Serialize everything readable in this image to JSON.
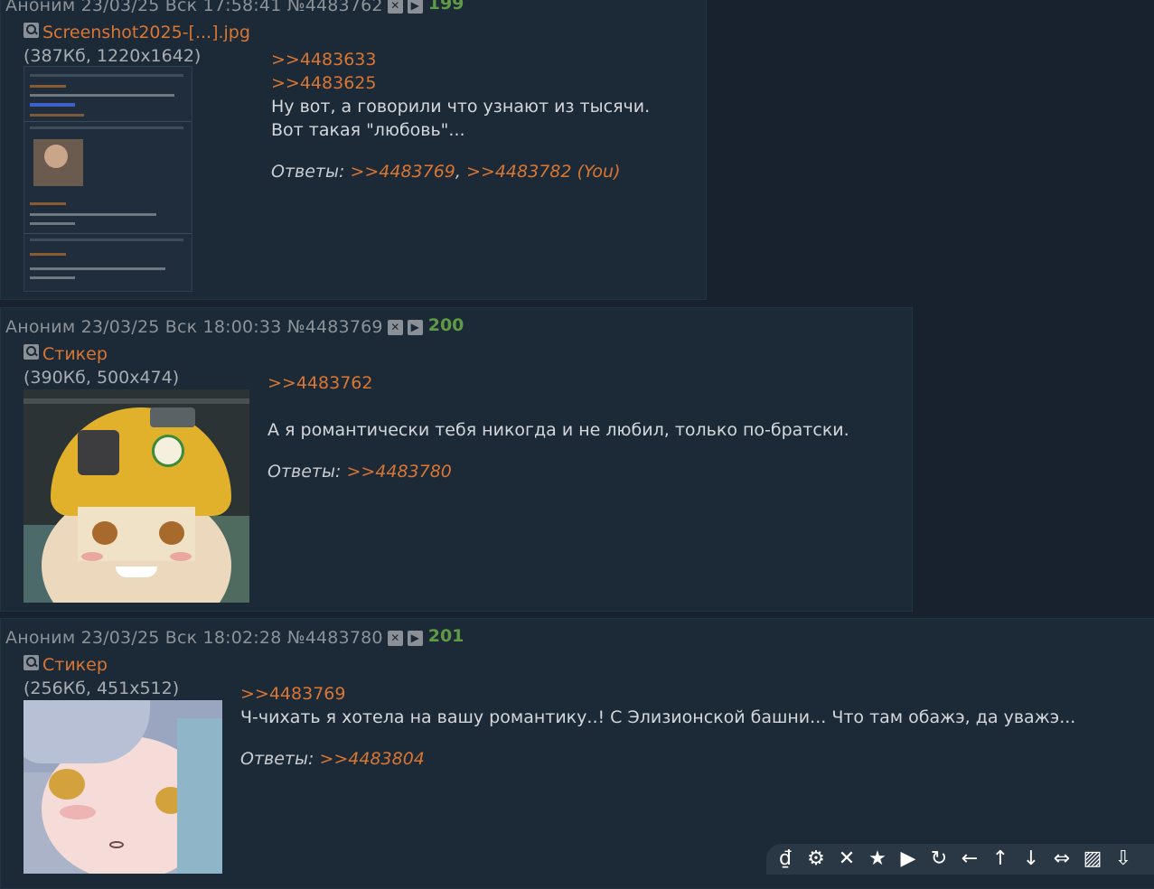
{
  "posts": [
    {
      "header": "Аноним 23/03/25 Вск 17:58:41 №4483762",
      "number": "199",
      "file_name": "Screenshot2025-[...].jpg",
      "file_info": "(387Кб, 1220x1642)",
      "lines": [
        ">>4483633",
        ">>4483625",
        "Ну вот, а говорили что узнают из тысячи.",
        "Вот такая \"любовь\"..."
      ],
      "replies_label": "Ответы:",
      "replies": [
        ">>4483769",
        ">>4483782 (You)"
      ]
    },
    {
      "header": "Аноним 23/03/25 Вск 18:00:33 №4483769",
      "number": "200",
      "file_name": "Стикер",
      "file_info": "(390Кб, 500x474)",
      "lines": [
        ">>4483762",
        "А я романтически тебя никогда и не любил, только по-братски."
      ],
      "replies_label": "Ответы:",
      "replies": [
        ">>4483780"
      ]
    },
    {
      "header": "Аноним 23/03/25 Вск 18:02:28 №4483780",
      "number": "201",
      "file_name": "Стикер",
      "file_info": "(256Кб, 451x512)",
      "lines": [
        ">>4483769",
        "Ч-чихать я хотела на вашу романтику..! С Элизионской башни... Что там обажэ, да уважэ..."
      ],
      "replies_label": "Ответы:",
      "replies": [
        ">>4483804"
      ]
    }
  ],
  "toolbar": {
    "buttons": [
      "logo-icon",
      "settings-icon",
      "close-icon",
      "favorites-icon",
      "play-icon",
      "refresh-icon",
      "arrow-left-icon",
      "arrow-up-icon",
      "arrow-down-icon",
      "expand-icon",
      "hide-images-icon",
      "download-icon",
      "save-icon"
    ],
    "glyphs": [
      "₫",
      "⚙",
      "✕",
      "★",
      "▶",
      "↻",
      "←",
      "↑",
      "↓",
      "⇔",
      "▨",
      "⇩",
      "💾"
    ]
  }
}
